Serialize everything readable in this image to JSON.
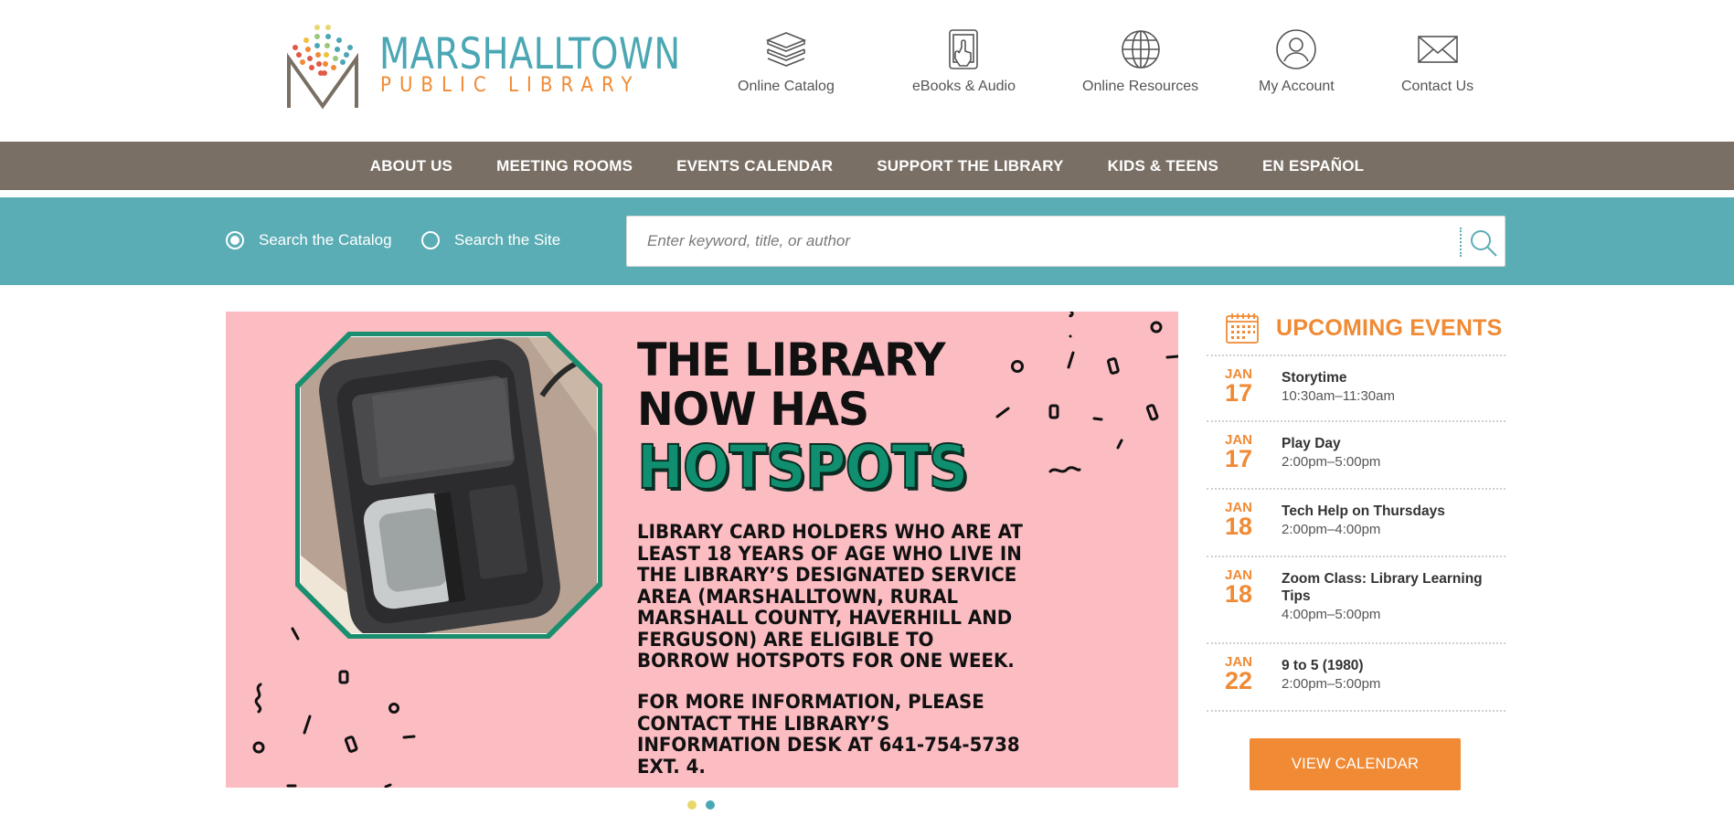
{
  "logo": {
    "title": "MARSHALLTOWN",
    "subtitle": "PUBLIC LIBRARY"
  },
  "quicklinks": [
    {
      "label": "Online Catalog",
      "icon": "books-stack-icon"
    },
    {
      "label": "eBooks & Audio",
      "icon": "tablet-touch-icon"
    },
    {
      "label": "Online Resources",
      "icon": "globe-icon"
    },
    {
      "label": "My Account",
      "icon": "user-icon"
    },
    {
      "label": "Contact Us",
      "icon": "envelope-icon"
    }
  ],
  "nav": {
    "items": [
      "ABOUT US",
      "MEETING ROOMS",
      "EVENTS CALENDAR",
      "SUPPORT THE LIBRARY",
      "KIDS & TEENS",
      "EN ESPAÑOL"
    ]
  },
  "search": {
    "options": [
      {
        "label": "Search the Catalog",
        "selected": true
      },
      {
        "label": "Search the Site",
        "selected": false
      }
    ],
    "placeholder": "Enter keyword, title, or author",
    "value": ""
  },
  "hero": {
    "headline_line1": "THE LIBRARY",
    "headline_line2": "NOW HAS",
    "highlight": "HOTSPOTS",
    "paragraph1": "LIBRARY CARD HOLDERS WHO ARE AT LEAST 18 YEARS OF AGE WHO LIVE IN THE LIBRARY’S DESIGNATED SERVICE AREA (MARSHALLTOWN, RURAL MARSHALL COUNTY, HAVERHILL AND FERGUSON) ARE ELIGIBLE TO BORROW HOTSPOTS FOR ONE WEEK.",
    "paragraph2": "FOR MORE INFORMATION, PLEASE CONTACT THE LIBRARY’S INFORMATION DESK AT 641-754-5738 EXT. 4.",
    "slide_count": 2,
    "active_slide": 2
  },
  "events": {
    "heading": "UPCOMING EVENTS",
    "items": [
      {
        "month": "JAN",
        "day": "17",
        "title": "Storytime",
        "time": "10:30am–11:30am"
      },
      {
        "month": "JAN",
        "day": "17",
        "title": "Play Day",
        "time": "2:00pm–5:00pm"
      },
      {
        "month": "JAN",
        "day": "18",
        "title": "Tech Help on Thursdays",
        "time": "2:00pm–4:00pm"
      },
      {
        "month": "JAN",
        "day": "18",
        "title": "Zoom Class: Library Learning Tips",
        "time": "4:00pm–5:00pm"
      },
      {
        "month": "JAN",
        "day": "22",
        "title": "9 to 5 (1980)",
        "time": "2:00pm–5:00pm"
      }
    ],
    "button_label": "VIEW CALENDAR"
  },
  "colors": {
    "teal": "#5aadb5",
    "orange": "#f08a34",
    "nav_brown": "#7a6f64",
    "hero_pink": "#fbbcc2",
    "hotspots_green": "#0f8f6f",
    "dot_yellow": "#e8d86a",
    "dot_teal": "#4aa7b3"
  }
}
